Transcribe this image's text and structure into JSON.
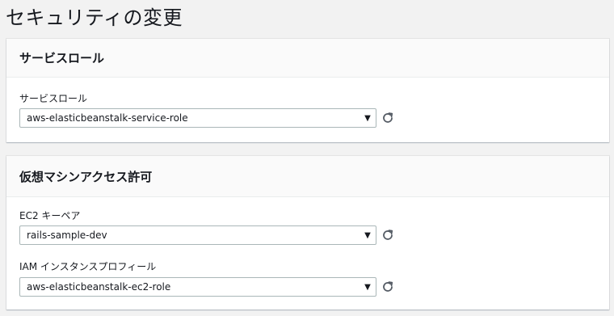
{
  "page": {
    "title": "セキュリティの変更"
  },
  "service_role_section": {
    "title": "サービスロール",
    "fields": [
      {
        "label": "サービスロール",
        "value": "aws-elasticbeanstalk-service-role"
      }
    ]
  },
  "vm_access_section": {
    "title": "仮想マシンアクセス許可",
    "fields": [
      {
        "label": "EC2 キーペア",
        "value": "rails-sample-dev"
      },
      {
        "label": "IAM インスタンスプロフィール",
        "value": "aws-elasticbeanstalk-ec2-role"
      }
    ]
  },
  "icons": {
    "dropdown": "caret-down-icon",
    "refresh": "refresh-icon"
  }
}
